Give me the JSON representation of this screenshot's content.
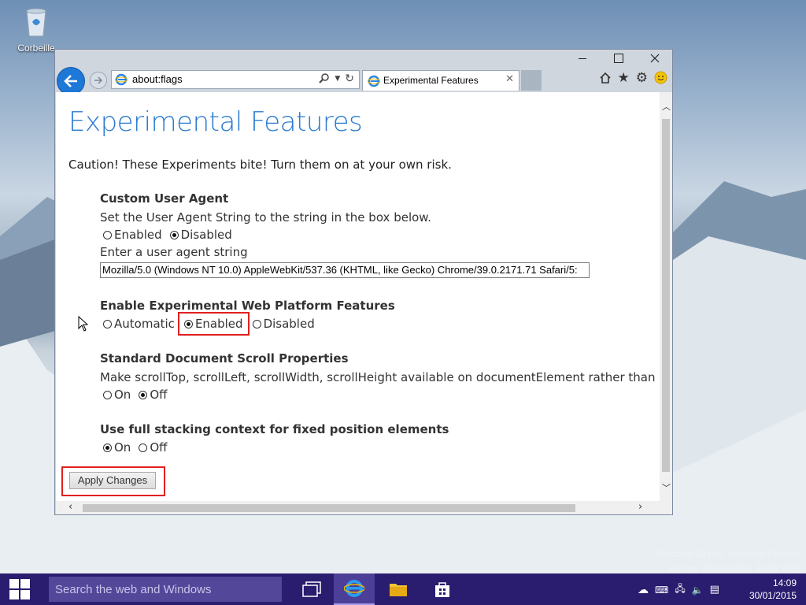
{
  "desktop": {
    "recycle_bin_label": "Corbeille"
  },
  "browser": {
    "address": "about:flags",
    "tab_title": "Experimental Features",
    "icons": [
      "back-arrow-icon",
      "forward-arrow-icon",
      "ie-logo-icon",
      "search-icon",
      "dropdown-icon",
      "refresh-icon",
      "close-icon",
      "home-icon",
      "favorites-star-icon",
      "gear-icon",
      "smiley-icon",
      "minimize-icon",
      "maximize-icon"
    ]
  },
  "page": {
    "title": "Experimental Features",
    "caution": "Caution! These Experiments bite! Turn them on at your own risk.",
    "ua": {
      "title": "Custom User Agent",
      "desc": "Set the User Agent String to the string in the box below.",
      "options": [
        "Enabled",
        "Disabled"
      ],
      "selected": "Disabled",
      "input_label": "Enter a user agent string",
      "input_value": "Mozilla/5.0 (Windows NT 10.0) AppleWebKit/537.36 (KHTML, like Gecko) Chrome/39.0.2171.71 Safari/5:"
    },
    "webplat": {
      "title": "Enable Experimental Web Platform Features",
      "options": [
        "Automatic",
        "Enabled",
        "Disabled"
      ],
      "selected": "Enabled"
    },
    "scroll": {
      "title": "Standard Document Scroll Properties",
      "desc": "Make scrollTop, scrollLeft, scrollWidth, scrollHeight available on documentElement rather than body e",
      "options": [
        "On",
        "Off"
      ],
      "selected": "Off"
    },
    "stacking": {
      "title": "Use full stacking context for fixed position elements",
      "options": [
        "On",
        "Off"
      ],
      "selected": "On"
    },
    "apply_label": "Apply Changes"
  },
  "watermark": {
    "line1": "Windows 10 Pro Technical Preview",
    "line2": "Version d'évaluation. Build 9926"
  },
  "taskbar": {
    "search_placeholder": "Search the web and Windows",
    "time": "14:09",
    "date": "30/01/2015",
    "accent_color": "#2a1c6e"
  }
}
